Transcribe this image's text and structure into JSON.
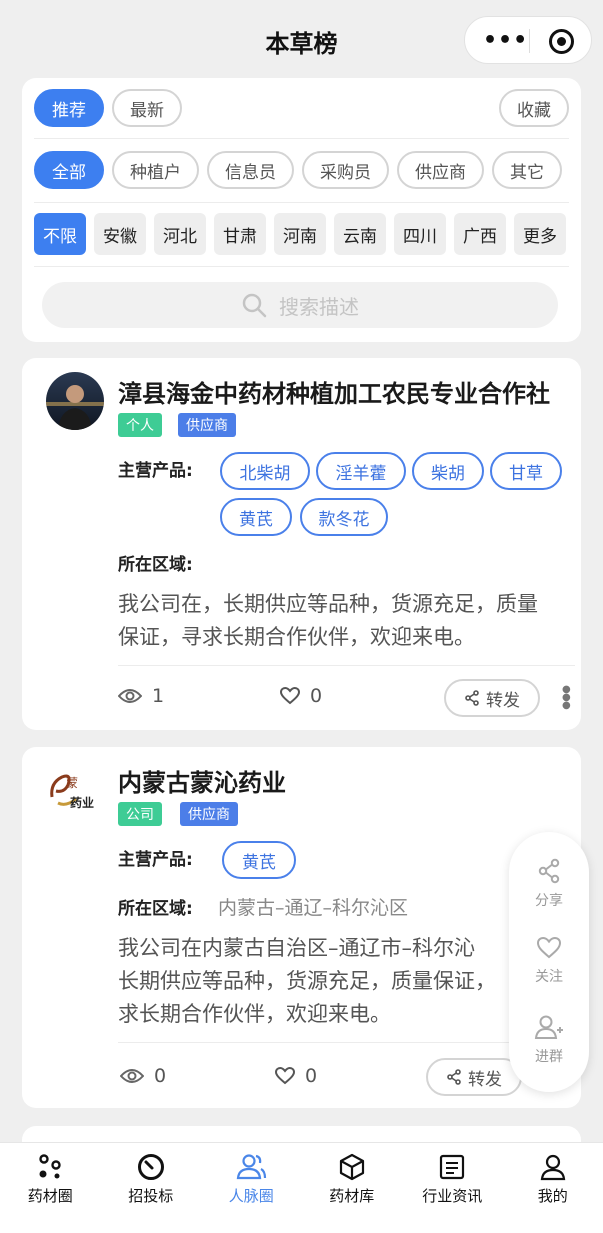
{
  "header": {
    "title": "本草榜"
  },
  "filters": {
    "sort_tabs": [
      "推荐",
      "最新"
    ],
    "favorite": "收藏",
    "roles": [
      "全部",
      "种植户",
      "信息员",
      "采购员",
      "供应商",
      "其它"
    ],
    "regions": [
      "不限",
      "安徽",
      "河北",
      "甘肃",
      "河南",
      "云南",
      "四川",
      "广西",
      "更多"
    ],
    "search_placeholder": "搜索描述"
  },
  "cards": [
    {
      "name": "漳县海金中药材种植加工农民专业合作社",
      "type_tag": "个人",
      "role_tag": "供应商",
      "products_label": "主营产品:",
      "products": [
        "北柴胡",
        "淫羊藿",
        "柴胡",
        "甘草",
        "黄芪",
        "款冬花"
      ],
      "region_label": "所在区域:",
      "region": "",
      "description_lines": [
        "我公司在，长期供应等品种，货源充足，质量",
        "保证，寻求长期合作伙伴，欢迎来电。"
      ],
      "views": "1",
      "likes": "0",
      "share_label": "转发"
    },
    {
      "name": "内蒙古蒙沁药业",
      "type_tag": "公司",
      "role_tag": "供应商",
      "products_label": "主营产品:",
      "products": [
        "黄芪"
      ],
      "region_label": "所在区域:",
      "region": "内蒙古–通辽–科尔沁区",
      "description_lines": [
        "我公司在内蒙古自治区–通辽市–科尔沁",
        "长期供应等品种，货源充足，质量保证，",
        "求长期合作伙伴，欢迎来电。"
      ],
      "views": "0",
      "likes": "0",
      "share_label": "转发",
      "logo_text": "药业"
    }
  ],
  "floating_actions": [
    "分享",
    "关注",
    "进群"
  ],
  "tabbar": {
    "items": [
      "药材圈",
      "招投标",
      "人脉圈",
      "药材库",
      "行业资讯",
      "我的"
    ],
    "active": "人脉圈",
    "active_color": "#4a86e8"
  },
  "colors": {
    "primary": "#3d7ff0",
    "tag_green": "#3ecc95",
    "tag_blue": "#4c7ee8"
  }
}
